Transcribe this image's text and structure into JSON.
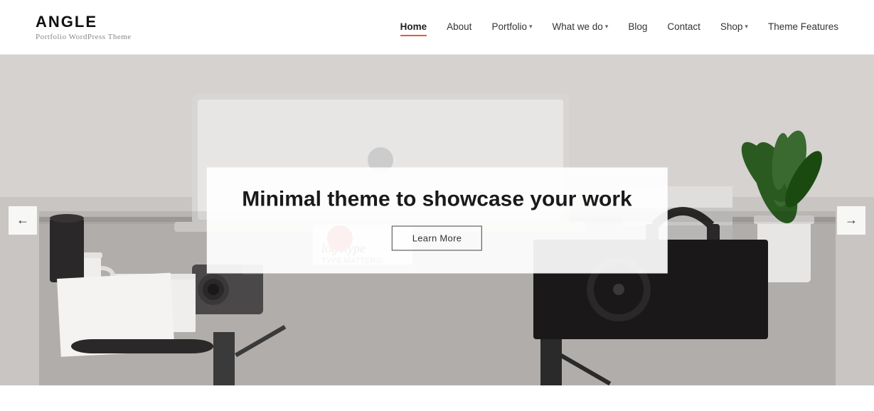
{
  "header": {
    "logo": {
      "title": "ANGLE",
      "subtitle": "Portfolio WordPress Theme"
    },
    "nav": {
      "items": [
        {
          "label": "Home",
          "active": true,
          "has_dropdown": false
        },
        {
          "label": "About",
          "active": false,
          "has_dropdown": false
        },
        {
          "label": "Portfolio",
          "active": false,
          "has_dropdown": true
        },
        {
          "label": "What we do",
          "active": false,
          "has_dropdown": true
        },
        {
          "label": "Blog",
          "active": false,
          "has_dropdown": false
        },
        {
          "label": "Contact",
          "active": false,
          "has_dropdown": false
        },
        {
          "label": "Shop",
          "active": false,
          "has_dropdown": true
        },
        {
          "label": "Theme Features",
          "active": false,
          "has_dropdown": false
        }
      ]
    }
  },
  "hero": {
    "heading": "Minimal theme to showcase your work",
    "cta_label": "Learn More",
    "arrow_left": "←",
    "arrow_right": "→"
  }
}
